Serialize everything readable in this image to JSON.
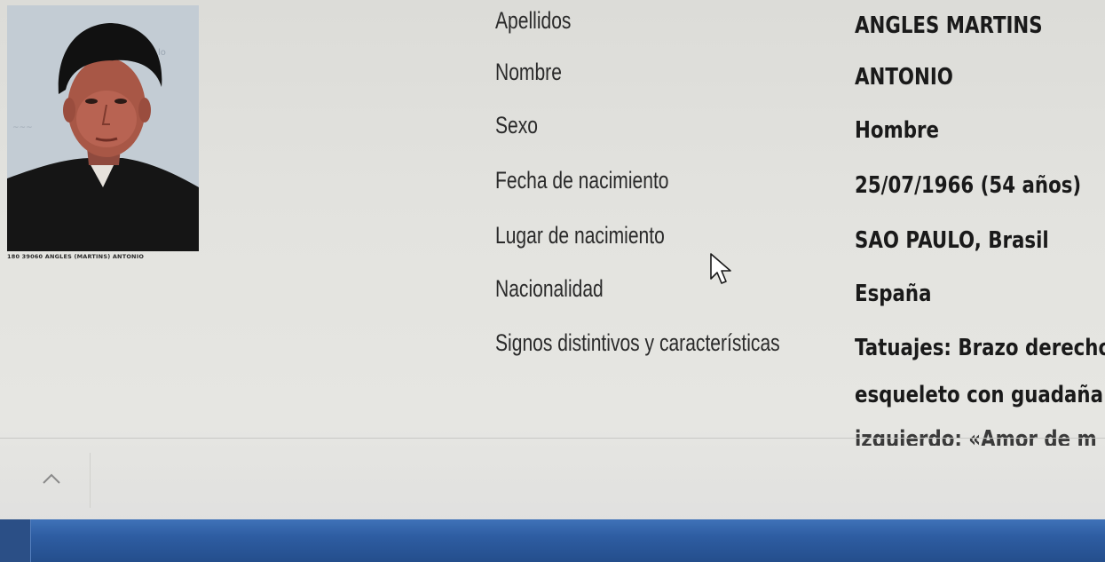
{
  "photo": {
    "caption": "180 39060 ANGLES (MARTINS) ANTONIO"
  },
  "details": [
    {
      "label": "Apellidos",
      "value": "ANGLES MARTINS"
    },
    {
      "label": "Nombre",
      "value": "ANTONIO"
    },
    {
      "label": "Sexo",
      "value": "Hombre"
    },
    {
      "label": "Fecha de nacimiento",
      "value": "25/07/1966 (54 años)"
    },
    {
      "label": "Lugar de nacimiento",
      "value": "SAO PAULO, Brasil"
    },
    {
      "label": "Nacionalidad",
      "value": "España"
    },
    {
      "label": "Signos distintivos y características",
      "value": "Tatuajes: Brazo derecho"
    }
  ],
  "details_continuation": [
    "esqueleto con guadaña",
    "izquierdo: «Amor de m"
  ],
  "controls": {
    "scroll_top_icon": "chevron-up-icon",
    "cursor_icon": "mouse-pointer-icon"
  },
  "colors": {
    "background": "#e3e3df",
    "taskbar": "#2e5da2"
  }
}
